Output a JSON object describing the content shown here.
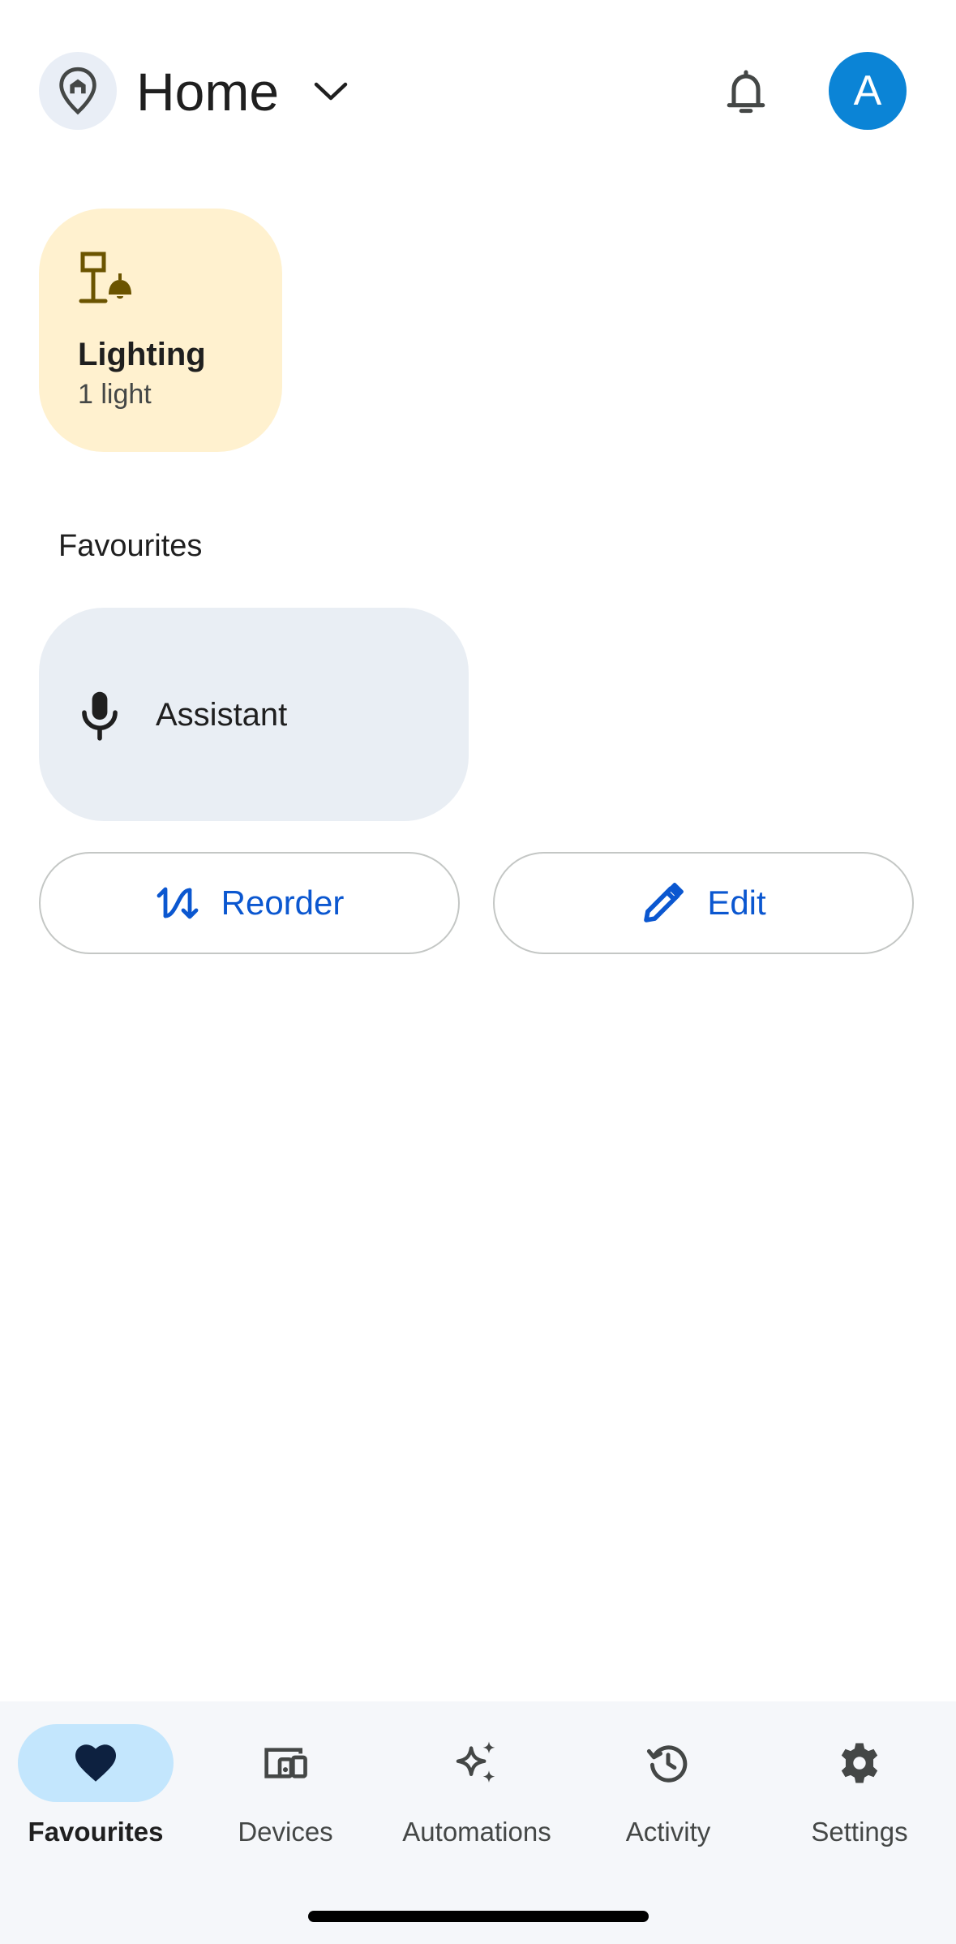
{
  "header": {
    "title": "Home",
    "avatar_initial": "A",
    "icons": {
      "location": "home-pin-icon",
      "chevron": "chevron-down-icon",
      "notifications": "bell-icon"
    }
  },
  "categories": [
    {
      "name": "Lighting",
      "count": "1 light",
      "icon": "lamp-icon",
      "color": "#fff1cf"
    }
  ],
  "favourites": {
    "title": "Favourites",
    "items": [
      {
        "label": "Assistant",
        "icon": "microphone-icon"
      }
    ]
  },
  "actions": {
    "reorder_label": "Reorder",
    "edit_label": "Edit"
  },
  "bottom_nav": {
    "items": [
      {
        "label": "Favourites",
        "icon": "heart-icon",
        "active": true
      },
      {
        "label": "Devices",
        "icon": "devices-icon",
        "active": false
      },
      {
        "label": "Automations",
        "icon": "sparkle-icon",
        "active": false
      },
      {
        "label": "Activity",
        "icon": "history-icon",
        "active": false
      },
      {
        "label": "Settings",
        "icon": "gear-icon",
        "active": false
      }
    ]
  },
  "colors": {
    "accent": "#0b57d0",
    "avatar": "#0b84d6",
    "nav_active_pill": "#c3e6fd",
    "assistant_card": "#e9eef4"
  }
}
